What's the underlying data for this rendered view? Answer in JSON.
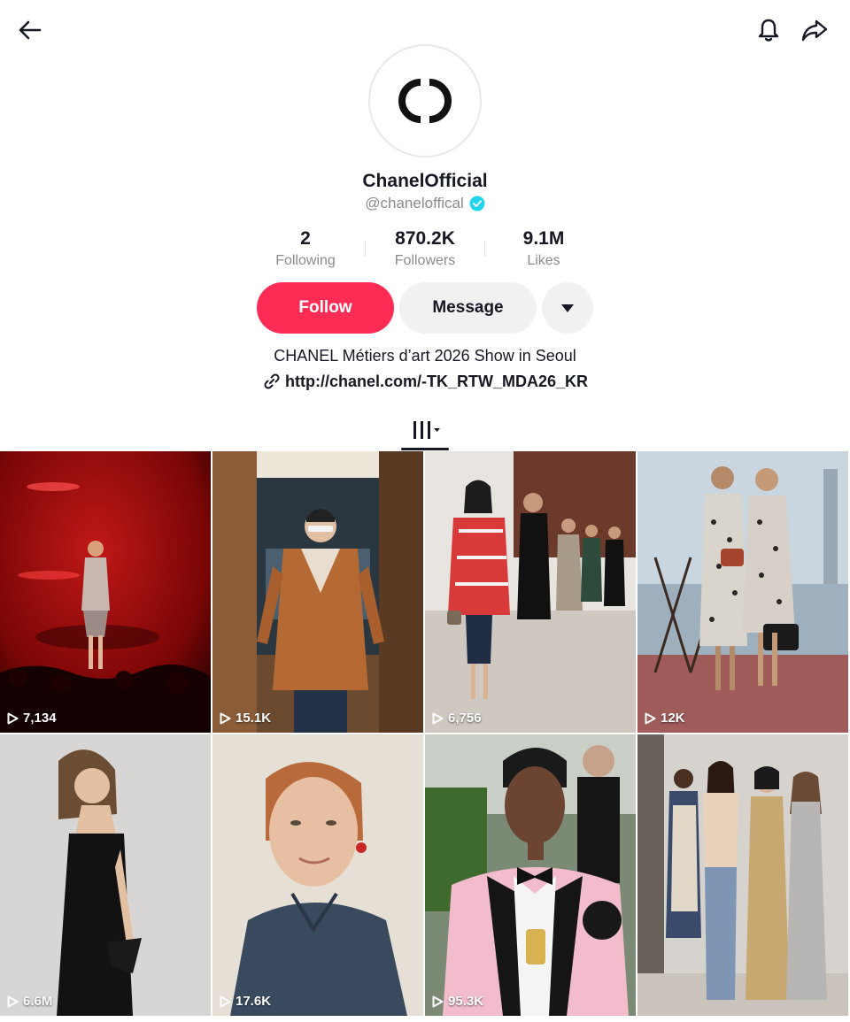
{
  "topbar": {
    "back_icon": "arrow-left-icon",
    "notification_icon": "bell-icon",
    "share_icon": "share-arrow-icon"
  },
  "profile": {
    "avatar_logo": "chanel-cc-logo",
    "display_name": "ChanelOfficial",
    "handle": "@chaneloffical",
    "verified": true,
    "verified_color": "#20d5ec"
  },
  "stats": {
    "following": {
      "value": "2",
      "label": "Following"
    },
    "followers": {
      "value": "870.2K",
      "label": "Followers"
    },
    "likes": {
      "value": "9.1M",
      "label": "Likes"
    }
  },
  "actions": {
    "follow_label": "Follow",
    "message_label": "Message",
    "follow_color": "#fe2c55"
  },
  "bio": {
    "text": "CHANEL Métiers d’art 2026 Show in Seoul",
    "link": "http://chanel.com/-TK_RTW_MDA26_KR"
  },
  "tabs": {
    "active": "videos",
    "videos_icon": "grid-bars-icon"
  },
  "videos": [
    {
      "views": "7,134",
      "scene": "red-stage-performer"
    },
    {
      "views": "15.1K",
      "scene": "woman-tweed-jacket-hallway"
    },
    {
      "views": "6,756",
      "scene": "runway-models"
    },
    {
      "views": "12K",
      "scene": "two-models-leopard-coats"
    },
    {
      "views": "6.6M",
      "scene": "woman-black-gown"
    },
    {
      "views": "17.6K",
      "scene": "woman-denim-portrait"
    },
    {
      "views": "95.3K",
      "scene": "man-pink-tuxedo"
    },
    {
      "views": "",
      "scene": "four-women-group"
    }
  ]
}
